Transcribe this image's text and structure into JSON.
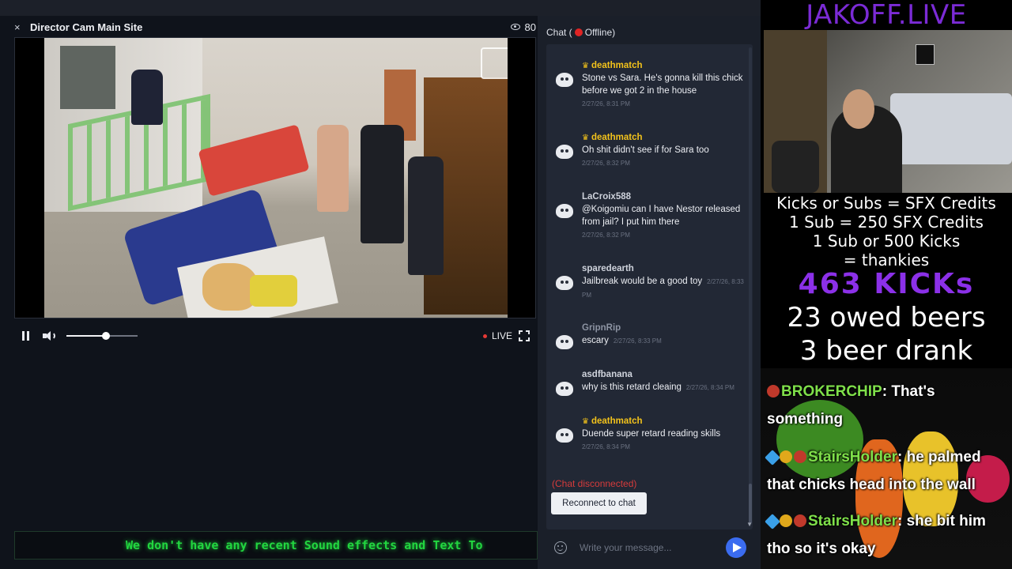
{
  "player": {
    "close_label": "×",
    "title": "Director Cam Main Site",
    "viewer_count": "80",
    "volume_level": 0.55,
    "live_label": "LIVE"
  },
  "ticker": {
    "text": "We don't have any recent Sound effects and Text To"
  },
  "chat": {
    "header_prefix": "Chat (",
    "header_status": "Offline)",
    "messages": [
      {
        "user": "deathmatch",
        "mod": true,
        "text": "Stone vs Sara. He's gonna kill this chick before we got 2 in the house",
        "time": "2/27/26, 8:31 PM"
      },
      {
        "user": "deathmatch",
        "mod": true,
        "text": "Oh shit didn't see if for Sara too",
        "time": "2/27/26, 8:32 PM"
      },
      {
        "user": "LaCroix588",
        "mod": false,
        "text": "@Koigomiu can I have Nestor released from jail? I put him there",
        "time": "2/27/26, 8:32 PM"
      },
      {
        "user": "sparedearth",
        "mod": false,
        "text": "Jailbreak would be a good toy",
        "time": "2/27/26, 8:33 PM"
      },
      {
        "user": "GripnRip",
        "mod": false,
        "text": "escary",
        "time": "2/27/26, 8:33 PM"
      },
      {
        "user": "asdfbanana",
        "mod": false,
        "text": "why is this retard cleaing",
        "time": "2/27/26, 8:34 PM"
      },
      {
        "user": "deathmatch",
        "mod": true,
        "text": "Duende super retard reading skills",
        "time": "2/27/26, 8:34 PM"
      }
    ],
    "disconnected_text": "(Chat disconnected)",
    "reconnect_label": "Reconnect to chat",
    "input_placeholder": "Write your message..."
  },
  "overlay": {
    "title": "JAKOFF.LIVE",
    "credits_lines": [
      "Kicks or Subs = SFX Credits",
      "1 Sub = 250 SFX Credits",
      "1 Sub or 500 Kicks",
      "= thankies"
    ],
    "kicks": "463 KICKs",
    "owed_beers": "23 owed beers",
    "beer_drank": "3 beer drank",
    "chat": [
      {
        "user": "BROKERCHIP",
        "text": "That's something"
      },
      {
        "user": "StairsHolder",
        "text": "he palmed that chicks head into the wall"
      },
      {
        "user": "StairsHolder",
        "text": "she bit him tho so it's okay"
      }
    ]
  },
  "colors": {
    "accent_gold": "#f2c21b",
    "offline_red": "#e02424",
    "overlay_purple": "#7b2bd6",
    "ticker_green": "#22d640",
    "send_blue": "#3b6cf0"
  }
}
